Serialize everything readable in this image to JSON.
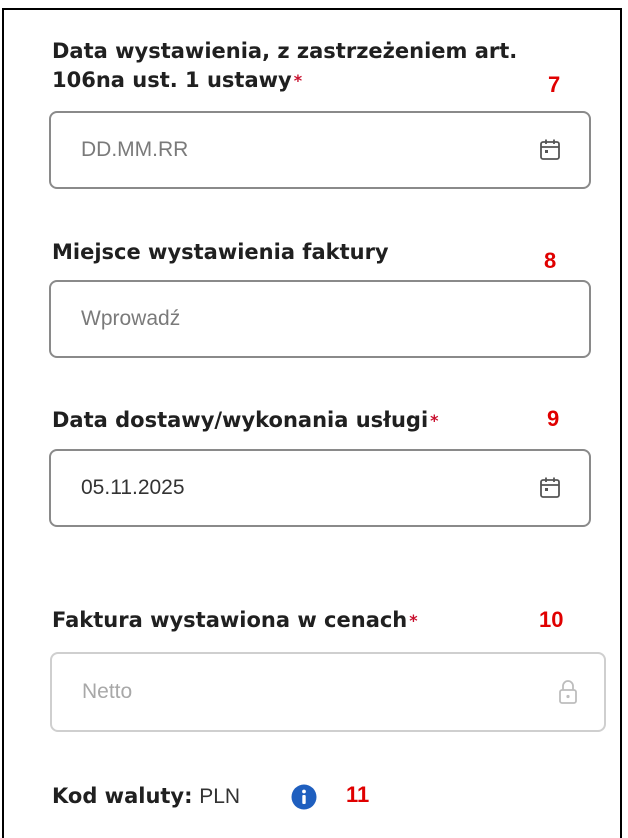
{
  "fields": {
    "issue_date": {
      "label_line1": "Data wystawienia, z zastrzeżeniem art.",
      "label_line2": "106na ust. 1 ustawy",
      "required_mark": "*",
      "step_number": "7",
      "placeholder": "DD.MM.RR",
      "icon": "calendar-icon"
    },
    "issue_place": {
      "label": "Miejsce wystawienia faktury",
      "step_number": "8",
      "placeholder": "Wprowadź"
    },
    "delivery_date": {
      "label": "Data dostawy/wykonania usługi",
      "required_mark": "*",
      "step_number": "9",
      "value": "05.11.2025",
      "icon": "calendar-icon"
    },
    "price_type": {
      "label": "Faktura wystawiona w cenach",
      "required_mark": "*",
      "step_number": "10",
      "value": "Netto",
      "icon": "lock-icon"
    },
    "currency": {
      "label": "Kod waluty:",
      "value": "PLN",
      "step_number": "11",
      "icon": "info-icon"
    }
  },
  "colors": {
    "required": "#c8102e",
    "step_number": "#e00000",
    "info": "#1f5fbf",
    "border": "#8a8a8a"
  }
}
